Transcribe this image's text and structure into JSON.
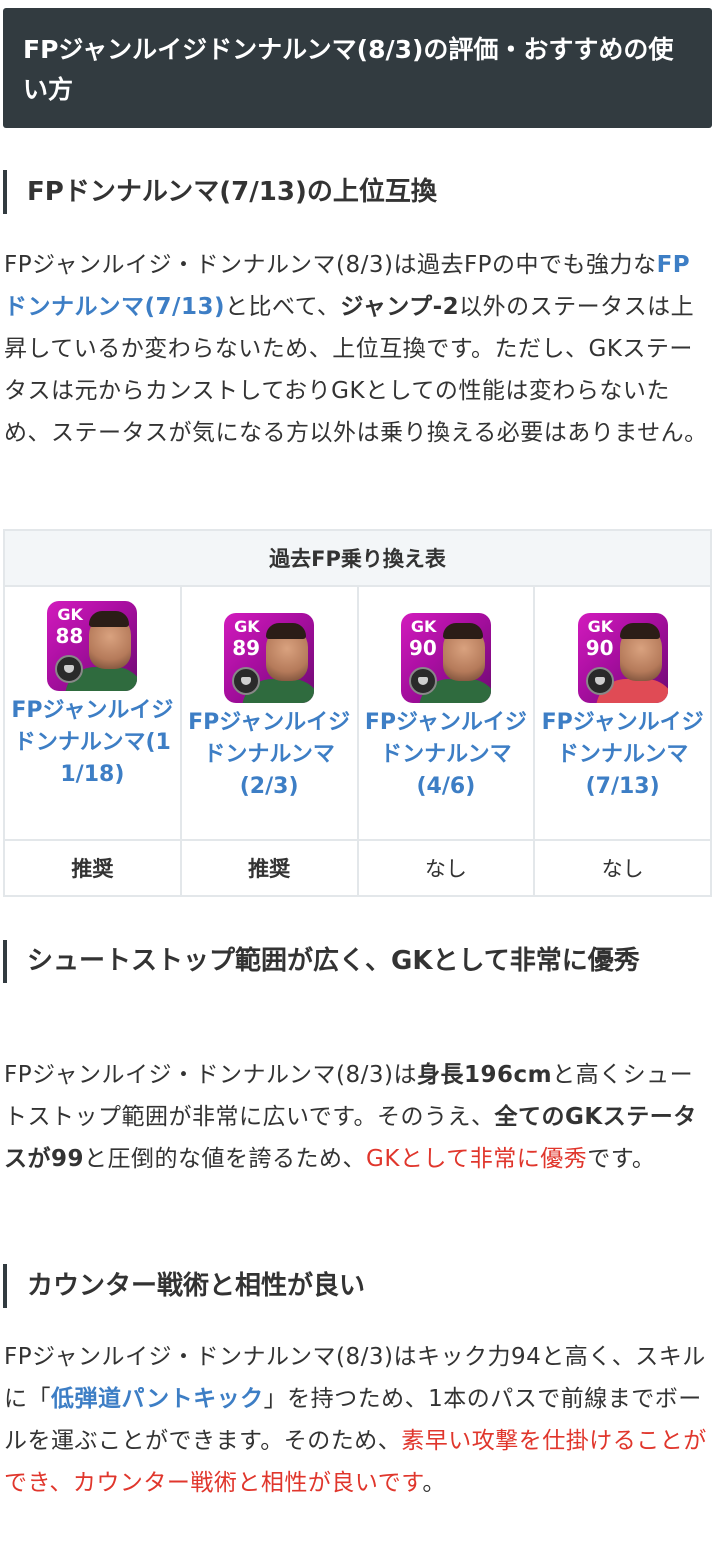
{
  "heading": "FPジャンルイジドンナルンマ(8/3)の評価・おすすめの使い方",
  "section1": {
    "title": "FPドンナルンマ(7/13)の上位互換",
    "p_a": "FPジャンルイジ・ドンナルンマ(8/3)は過去FPの中でも強力な",
    "p_link": "FPドンナルンマ(7/13)",
    "p_b": "と比べて、",
    "p_bold": "ジャンプ-2",
    "p_c": "以外のステータスは上昇しているか変わらないため、上位互換です。ただし、GKステータスは元からカンストしておりGKとしての性能は変わらないため、ステータスが気になる方以外は乗り換える必要はありません。"
  },
  "table": {
    "caption": "過去FP乗り換え表",
    "players": [
      {
        "pos": "GK",
        "rating": "88",
        "name": "FPジャンルイジドンナルンマ(11/18)",
        "rec": "推奨",
        "kit": "green"
      },
      {
        "pos": "GK",
        "rating": "89",
        "name": "FPジャンルイジドンナルンマ(2/3)",
        "rec": "推奨",
        "kit": "green"
      },
      {
        "pos": "GK",
        "rating": "90",
        "name": "FPジャンルイジドンナルンマ(4/6)",
        "rec": "なし",
        "kit": "green"
      },
      {
        "pos": "GK",
        "rating": "90",
        "name": "FPジャンルイジドンナルンマ(7/13)",
        "rec": "なし",
        "kit": "red"
      }
    ]
  },
  "section2": {
    "title": "シュートストップ範囲が広く、GKとして非常に優秀",
    "p_a": "FPジャンルイジ・ドンナルンマ(8/3)は",
    "p_bold1": "身長196cm",
    "p_b": "と高くシュートストップ範囲が非常に広いです。そのうえ、",
    "p_bold2": "全てのGKステータスが99",
    "p_c": "と圧倒的な値を誇るため、",
    "p_red": "GKとして非常に優秀",
    "p_d": "です。"
  },
  "section3": {
    "title": "カウンター戦術と相性が良い",
    "p_a": "FPジャンルイジ・ドンナルンマ(8/3)はキック力94と高く、スキルに「",
    "p_link": "低弾道パントキック",
    "p_b": "」を持つため、1本のパスで前線までボールを運ぶことができます。そのため、",
    "p_red": "素早い攻撃を仕掛けることができ、カウンター戦術と相性が良いです",
    "p_c": "。"
  }
}
